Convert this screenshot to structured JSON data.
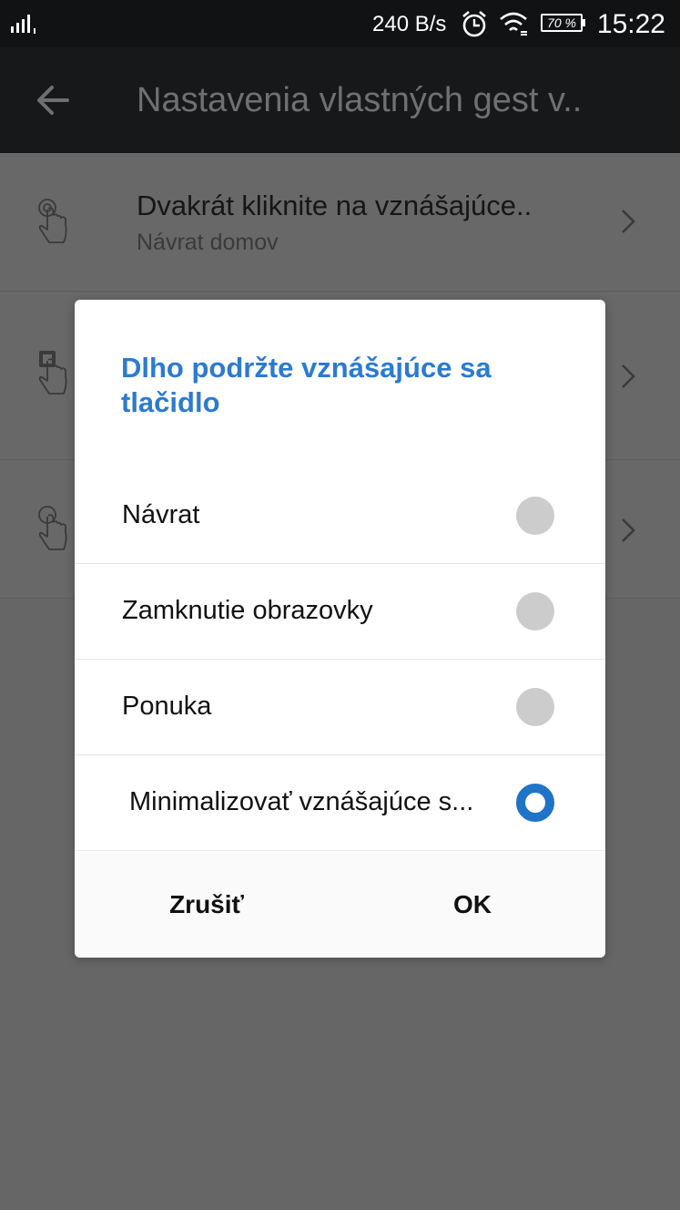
{
  "status_bar": {
    "signal_icon": "signal-bars-icon",
    "speed": "240 B/s",
    "alarm_icon": "alarm-clock-icon",
    "wifi_icon": "wifi-icon",
    "battery_level": "70 %",
    "time": "15:22"
  },
  "app_bar": {
    "back_icon": "back-arrow-icon",
    "title": "Nastavenia vlastných gest v.."
  },
  "list": {
    "items": [
      {
        "icon": "double-tap-gesture-icon",
        "title": "Dvakrát kliknite na vznášajúce..",
        "subtitle": "Návrat domov"
      },
      {
        "icon": "long-press-gesture-icon",
        "title": "",
        "subtitle": ""
      },
      {
        "icon": "tap-gesture-icon",
        "title": "",
        "subtitle": ""
      }
    ]
  },
  "dialog": {
    "title": "Dlho podržte vznášajúce sa tlačidlo",
    "options": [
      {
        "label": "Návrat",
        "selected": false
      },
      {
        "label": "Zamknutie obrazovky",
        "selected": false
      },
      {
        "label": "Ponuka",
        "selected": false
      },
      {
        "label": "Minimalizovať vznášajúce s...",
        "selected": true
      }
    ],
    "cancel_label": "Zrušiť",
    "ok_label": "OK"
  },
  "colors": {
    "accent": "#2b7bd0",
    "radio_selected": "#1f73c8",
    "radio_unselected": "#cccccc",
    "scrim": "#666666",
    "app_bar": "#161819"
  }
}
